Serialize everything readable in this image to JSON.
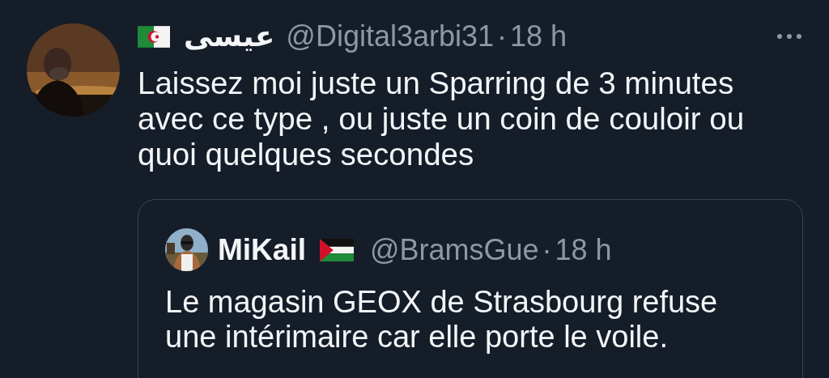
{
  "tweet": {
    "author": {
      "flag": {
        "kind": "algeria"
      },
      "name": "عيسى",
      "handle": "@Digital3arbi31",
      "separator": "·",
      "time": "18 h"
    },
    "text_lines": [
      "Laissez moi juste un Sparring de 3 minutes",
      "avec ce type , ou juste un coin de couloir ou",
      "quoi quelques secondes"
    ],
    "quoted": {
      "author": {
        "name": "MiKail",
        "flag": {
          "kind": "palestine"
        },
        "handle": "@BramsGue",
        "separator": "·",
        "time": "18 h"
      },
      "text_lines": [
        "Le magasin GEOX de Strasbourg refuse",
        "une intérimaire car elle porte le voile."
      ]
    }
  }
}
